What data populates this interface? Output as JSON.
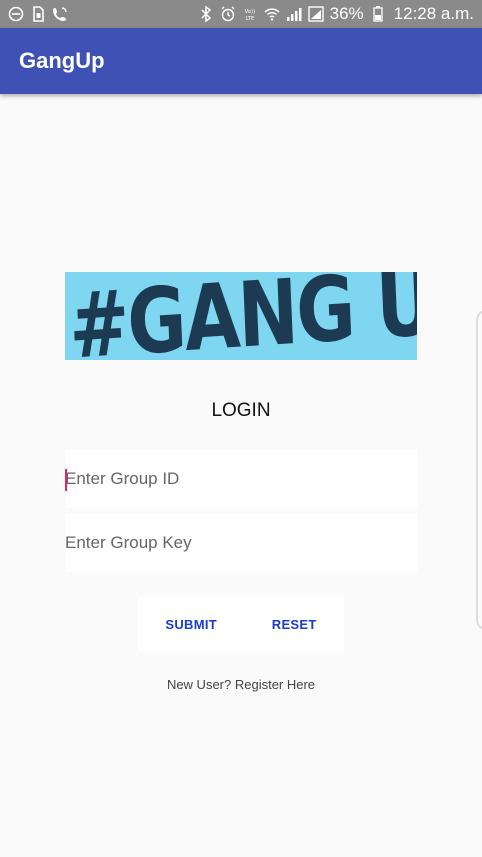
{
  "status_bar": {
    "battery_percent": "36%",
    "time": "12:28 a.m.",
    "left_icons": [
      "do-not-disturb-icon",
      "sim-icon",
      "wifi-calling-icon"
    ],
    "right_icons": [
      "bluetooth-icon",
      "alarm-icon",
      "volte-icon",
      "wifi-icon",
      "signal-icon",
      "signal-2-icon",
      "battery-icon"
    ]
  },
  "app_bar": {
    "title": "GangUp",
    "color": "#3f51b5"
  },
  "banner": {
    "text": "#GANG UP",
    "background": "#7fd6f0"
  },
  "login": {
    "title": "LOGIN",
    "group_id_placeholder": "Enter Group ID",
    "group_key_placeholder": "Enter Group Key",
    "submit_label": "SUBMIT",
    "reset_label": "RESET",
    "register_link": "New User? Register Here"
  },
  "colors": {
    "accent": "#e91e63",
    "button_text": "#1a3cd0"
  }
}
